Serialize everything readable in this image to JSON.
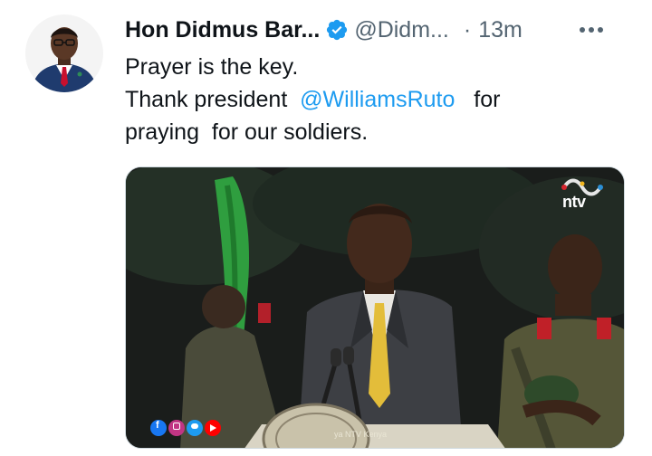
{
  "author": {
    "display_name": "Hon Didmus Bar...",
    "handle": "@Didm...",
    "separator": "·",
    "time": "13m"
  },
  "tweet": {
    "line1": "Prayer is the key.",
    "line2_prefix": "Thank president  ",
    "line2_mention": "@WilliamsRuto",
    "line2_suffix": "   for",
    "line3": "praying  for our soldiers."
  },
  "media": {
    "channel": "ntv",
    "ticker": "ya NTV Kenya"
  },
  "icons": {
    "verified": "verified-badge-icon",
    "more": "more-horizontal-icon",
    "social": [
      "facebook-icon",
      "instagram-icon",
      "twitter-icon",
      "youtube-icon"
    ]
  },
  "colors": {
    "accent": "#1d9bf0",
    "secondary_text": "#536471"
  }
}
